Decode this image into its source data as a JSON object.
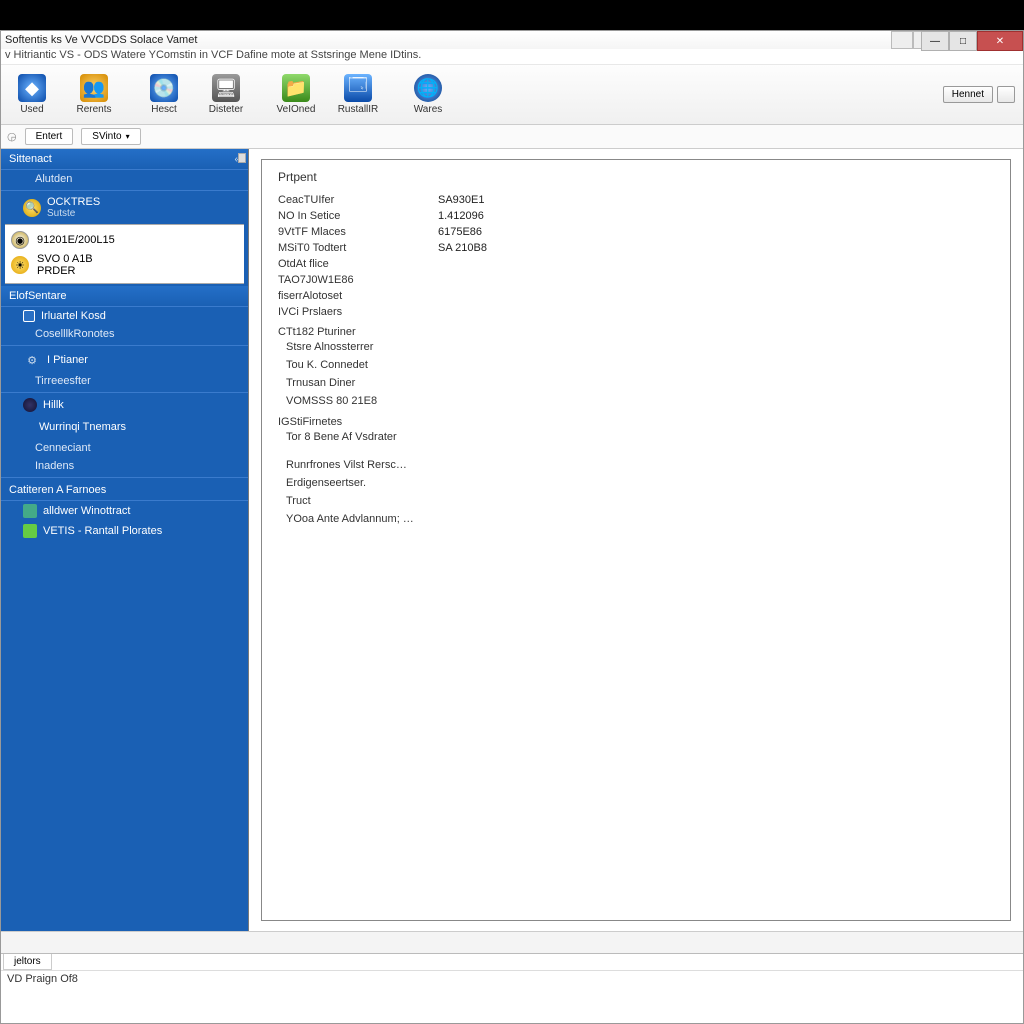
{
  "window": {
    "title": "Softentis ks Ve VVCDDS Solace Vamet",
    "subtitle": "v Hitriantic VS - ODS Watere YComstin in VCF Dafine mote at Sstsringe Mene IDtins."
  },
  "toolbar": {
    "items": [
      {
        "label": "Used",
        "icon": "shield"
      },
      {
        "label": "Rerents",
        "icon": "users"
      },
      {
        "label": "Hesct",
        "icon": "disk"
      },
      {
        "label": "Disteter",
        "icon": "server"
      },
      {
        "label": "VeIOned",
        "icon": "folder"
      },
      {
        "label": "RustallIR",
        "icon": "window"
      },
      {
        "label": "Wares",
        "icon": "globe"
      }
    ],
    "right_button": "Hennet"
  },
  "subbar": {
    "tab1": "Entert",
    "tab2": "SVinto"
  },
  "sidebar": {
    "header": "Sittenact",
    "item_about": "Alutden",
    "group1_title": "OCKTRES",
    "group1_sub": "Sutste",
    "selected": {
      "line1": "91201E/200L15",
      "line2": "SVO 0 A1B",
      "line3": "PRDER"
    },
    "section2": "ElofSentare",
    "sec2_items": [
      "Irluartel Kosd",
      "CoselllkRonotes"
    ],
    "sec3_items": [
      "I Ptianer",
      "Tirreeesfter"
    ],
    "sec4_items": [
      "Hillk",
      "Wurrinqi Tnemars",
      "Cenneciant",
      "Inadens"
    ],
    "section5": "Catiteren A Farnoes",
    "sec5_items": [
      "alldwer Winottract",
      "VETIS - Rantall Plorates"
    ]
  },
  "main": {
    "title": "Prtpent",
    "rows": [
      {
        "k": "CeacTUIfer",
        "v": "SA930E1"
      },
      {
        "k": "NO In Setice",
        "v": "1.412096"
      },
      {
        "k": "9VtTF Mlaces",
        "v": "6175E86"
      },
      {
        "k": "MSiT0 Todtert",
        "v": "SA 210B8"
      },
      {
        "k": "OtdAt flice",
        "v": ""
      },
      {
        "k": "TAO7J0W1E86",
        "v": ""
      },
      {
        "k": "fiserrAlotoset",
        "v": ""
      },
      {
        "k": "IVCi Prslaers",
        "v": ""
      }
    ],
    "heading2": "CTt182 Pturiner",
    "rows2": [
      "Stsre Alnossterrer",
      "Tou K. Connedet",
      "Trnusan Diner",
      "VOMSSS 80 21E8"
    ],
    "heading3": "IGStiFirnetes",
    "row3": "Tor 8 Bene Af Vsdrater",
    "links": [
      "Runrfrones Vilst Rersc…",
      "Erdigenseertser.",
      "Truct",
      "YOoa Ante Advlannum; …"
    ]
  },
  "bottom": {
    "tab": "jeltors",
    "line": "VD Praign Of8"
  }
}
